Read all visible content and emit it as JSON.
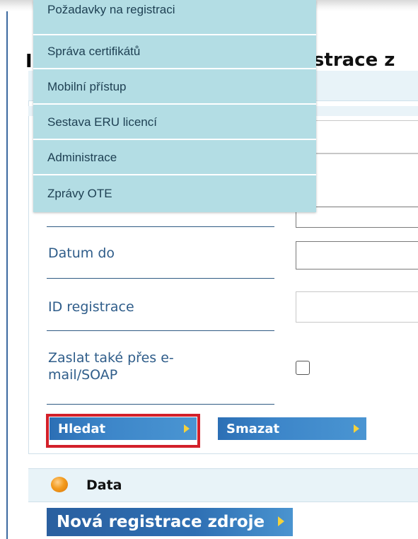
{
  "header": {
    "title_fragment": "istrace z",
    "left_fragment": "I"
  },
  "dropdown_menu": {
    "items": [
      {
        "label": "Požadavky na registraci"
      },
      {
        "label": "Správa certifikátů"
      },
      {
        "label": "Mobilní přístup"
      },
      {
        "label": "Sestava ERU licencí"
      },
      {
        "label": "Administrace"
      },
      {
        "label": "Zprávy OTE"
      }
    ]
  },
  "form": {
    "date_to_label": "Datum do",
    "registration_id_label": "ID registrace",
    "send_email_label": "Zaslat také přes e-mail/SOAP"
  },
  "buttons": {
    "search_label": "Hledat",
    "clear_label": "Smazat",
    "new_registration_label": "Nová registrace zdroje"
  },
  "data_section": {
    "title": "Data"
  },
  "colors": {
    "menu_bg": "#b3dde4",
    "label_blue": "#2f5d8a",
    "button_blue": "#3d86c9",
    "highlight_red": "#d3202a",
    "arrow_yellow": "#f4d23c"
  }
}
